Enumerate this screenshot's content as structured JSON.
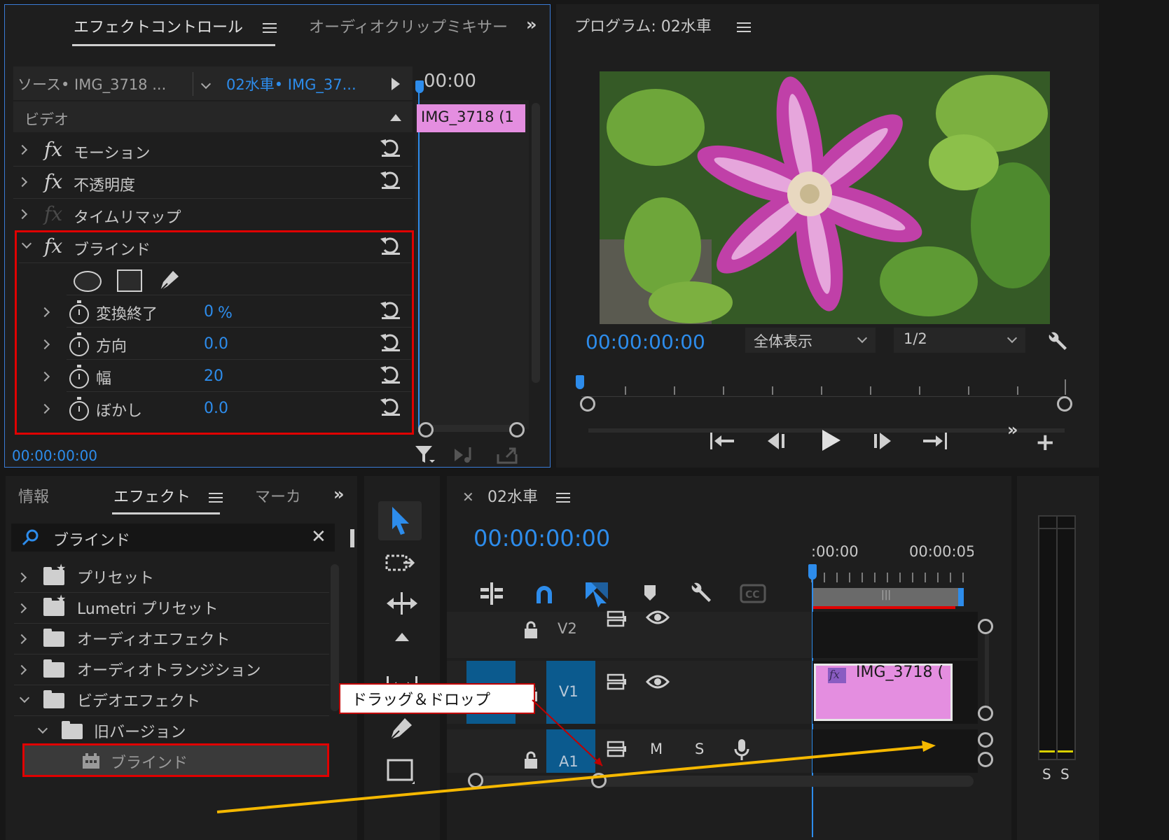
{
  "effect_controls": {
    "tab_active": "エフェクトコントロール",
    "tab_other": "オーディオクリップミキサー",
    "source_label": "ソース• IMG_3718 ...",
    "sequence_label": "02水車• IMG_37...",
    "timecode_top": "00:00",
    "clip_label": "IMG_3718 (1",
    "section": "ビデオ",
    "effects": [
      {
        "name": "モーション"
      },
      {
        "name": "不透明度"
      },
      {
        "name": "タイムリマップ"
      },
      {
        "name": "ブラインド"
      }
    ],
    "params": [
      {
        "name": "変換終了",
        "value": "0",
        "unit": "%"
      },
      {
        "name": "方向",
        "value": "0.0"
      },
      {
        "name": "幅",
        "value": "20"
      },
      {
        "name": "ぼかし",
        "value": "0.0"
      }
    ],
    "timecode_bottom": "00:00:00:00"
  },
  "program": {
    "title": "プログラム: 02水車",
    "timecode": "00:00:00:00",
    "zoom": "全体表示",
    "resolution": "1/2"
  },
  "effects_panel": {
    "tab_info": "情報",
    "tab_effects": "エフェクト",
    "tab_markers": "マーカ",
    "search_value": "ブラインド",
    "items": [
      {
        "label": "プリセット"
      },
      {
        "label": "Lumetri プリセット"
      },
      {
        "label": "オーディオエフェクト"
      },
      {
        "label": "オーディオトランジション"
      },
      {
        "label": "ビデオエフェクト"
      },
      {
        "label": "旧バージョン"
      },
      {
        "label": "ブラインド"
      }
    ]
  },
  "timeline": {
    "title": "02水車",
    "timecode": "00:00:00:00",
    "ruler_start": ":00:00",
    "ruler_end": "00:00:05",
    "tracks": {
      "v2": "V2",
      "v1": "V1",
      "a1": "A1",
      "m": "M",
      "s": "S"
    },
    "clip_label": "IMG_3718 (",
    "fx_badge": "fx"
  },
  "meter": {
    "s1": "S",
    "s2": "S"
  },
  "annotation": {
    "label": "ドラッグ＆ドロップ"
  },
  "colors": {
    "accent": "#2d8ceb",
    "clip": "#e48ee0",
    "highlight": "#e00000",
    "arrow": "#f5b800",
    "track": "#0b5a8e"
  }
}
